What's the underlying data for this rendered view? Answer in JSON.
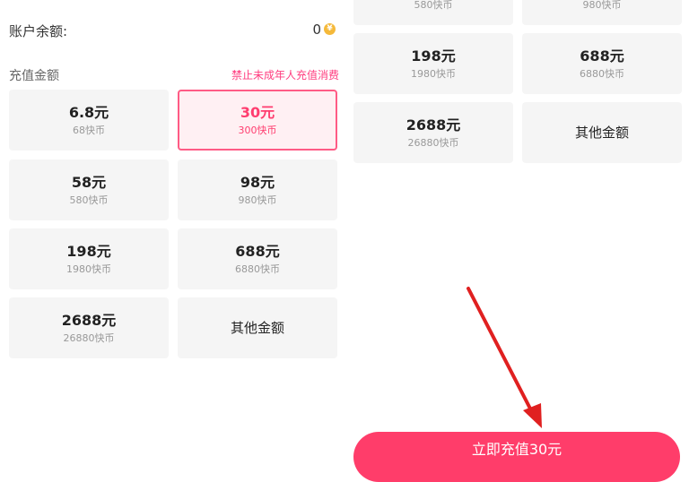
{
  "balance": {
    "label": "账户余额:",
    "value": "0"
  },
  "recharge": {
    "label": "充值金额",
    "warning": "禁止未成年人充值消费"
  },
  "options": [
    {
      "price": "6.8元",
      "coins": "68快币"
    },
    {
      "price": "30元",
      "coins": "300快币",
      "selected": true
    },
    {
      "price": "58元",
      "coins": "580快币"
    },
    {
      "price": "98元",
      "coins": "980快币"
    },
    {
      "price": "198元",
      "coins": "1980快币"
    },
    {
      "price": "688元",
      "coins": "6880快币"
    },
    {
      "price": "2688元",
      "coins": "26880快币"
    },
    {
      "price": "其他金额"
    }
  ],
  "pay_button": {
    "label": "立即充值30元"
  },
  "colors": {
    "accent": "#ff3d6a",
    "coin": "#f5b93a",
    "arrow": "#e02020"
  }
}
